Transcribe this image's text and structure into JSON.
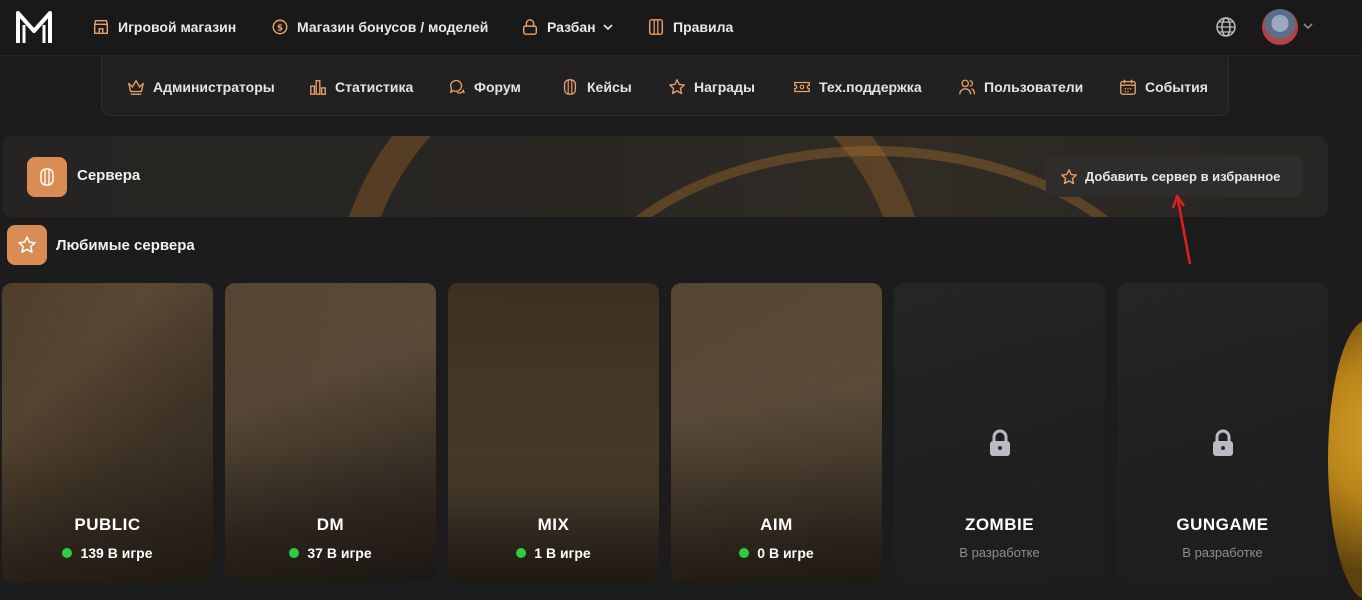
{
  "nav": {
    "items": [
      {
        "label": "Игровой магазин",
        "icon": "shop-icon"
      },
      {
        "label": "Магазин бонусов / моделей",
        "icon": "coin-icon"
      },
      {
        "label": "Разбан",
        "icon": "unlock-icon"
      },
      {
        "label": "Правила",
        "icon": "rules-icon"
      }
    ]
  },
  "subnav": {
    "items": [
      {
        "label": "Администраторы",
        "icon": "crown-icon"
      },
      {
        "label": "Статистика",
        "icon": "stats-icon"
      },
      {
        "label": "Форум",
        "icon": "forum-icon"
      },
      {
        "label": "Кейсы",
        "icon": "case-icon"
      },
      {
        "label": "Награды",
        "icon": "star-icon"
      },
      {
        "label": "Тех.поддержка",
        "icon": "ticket-icon"
      },
      {
        "label": "Пользователи",
        "icon": "users-icon"
      },
      {
        "label": "События",
        "icon": "calendar-icon"
      }
    ]
  },
  "banner": {
    "title": "Сервера",
    "fav_button": "Добавить сервер в избранное"
  },
  "favorites": {
    "title": "Любимые сервера"
  },
  "servers": [
    {
      "name": "PUBLIC",
      "status": "139 В игре",
      "online": true
    },
    {
      "name": "DM",
      "status": "37 В игре",
      "online": true
    },
    {
      "name": "MIX",
      "status": "1 В игре",
      "online": true
    },
    {
      "name": "AIM",
      "status": "0 В игре",
      "online": true
    },
    {
      "name": "ZOMBIE",
      "status": "В разработке",
      "online": false
    },
    {
      "name": "GUNGAME",
      "status": "В разработке",
      "online": false
    }
  ],
  "colors": {
    "accent": "#d98d55",
    "online": "#2ecc40",
    "background": "#1d1c1c"
  }
}
